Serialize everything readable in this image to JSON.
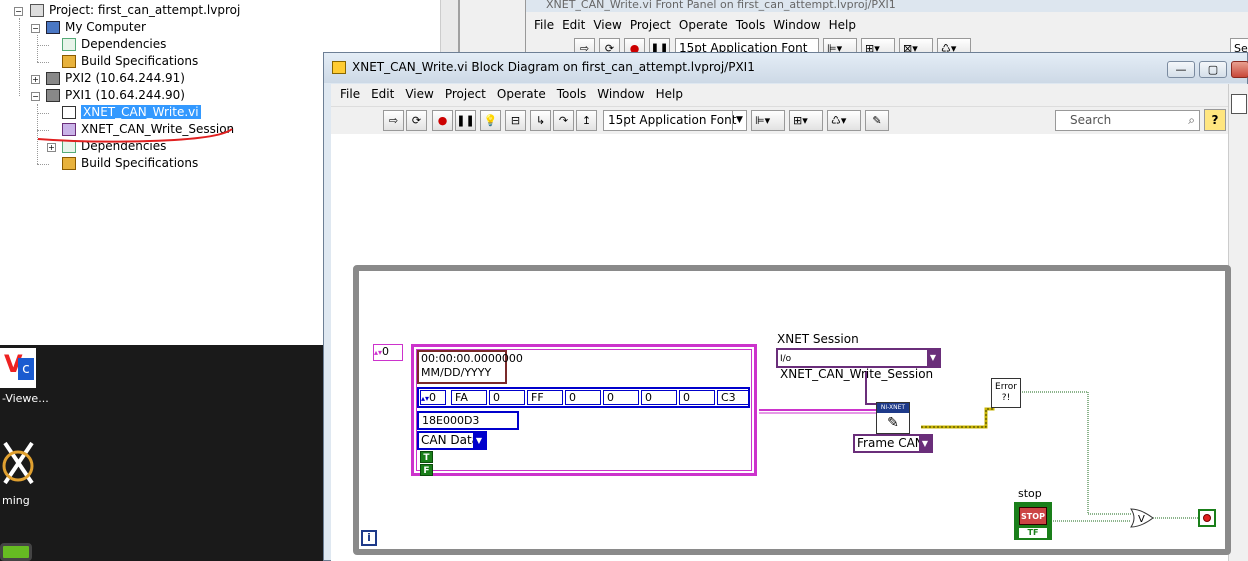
{
  "project": {
    "root": "Project: first_can_attempt.lvproj",
    "items": [
      {
        "label": "My Computer"
      },
      {
        "label": "Dependencies"
      },
      {
        "label": "Build Specifications"
      },
      {
        "label": "PXI2 (10.64.244.91)"
      },
      {
        "label": "PXI1 (10.64.244.90)"
      },
      {
        "label": "XNET_CAN_Write.vi"
      },
      {
        "label": "XNET_CAN_Write_Session"
      },
      {
        "label": "Dependencies"
      },
      {
        "label": "Build Specifications"
      }
    ]
  },
  "desktop": {
    "vnc_label": "-Viewe...",
    "app_label": "ming"
  },
  "front_panel": {
    "title": "XNET_CAN_Write.vi Front Panel on first_can_attempt.lvproj/PXI1",
    "menu": [
      "File",
      "Edit",
      "View",
      "Project",
      "Operate",
      "Tools",
      "Window",
      "Help"
    ],
    "font": "15pt Application Font",
    "search_stub": "Se"
  },
  "block_diagram": {
    "title": "XNET_CAN_Write.vi Block Diagram on first_can_attempt.lvproj/PXI1",
    "menu": [
      "File",
      "Edit",
      "View",
      "Project",
      "Operate",
      "Tools",
      "Window",
      "Help"
    ],
    "font": "15pt Application Font",
    "search_placeholder": "Search",
    "help": "?",
    "window_buttons": {
      "minimize": "—",
      "maximize": "▢"
    },
    "diagram": {
      "outer_index": "0",
      "timestamp": "00:00:00.0000000",
      "date_format": "MM/DD/YYYY",
      "payload_index": "0",
      "payload": [
        "FA",
        "0",
        "FF",
        "0",
        "0",
        "0",
        "0",
        "C3"
      ],
      "identifier": "18E000D3",
      "frame_type": "CAN Data",
      "bool_true": "T",
      "bool_false": "F",
      "session_label": "XNET Session",
      "session_value": "XNET_CAN_Write_Session",
      "session_prefix": "I/o",
      "write_node_label": "NI-XNET",
      "frame_mode": "Frame CAN",
      "error_label": "Error ?!",
      "stop_label": "stop",
      "stop_button": "STOP",
      "stop_tf": "TF",
      "info": "i"
    }
  }
}
